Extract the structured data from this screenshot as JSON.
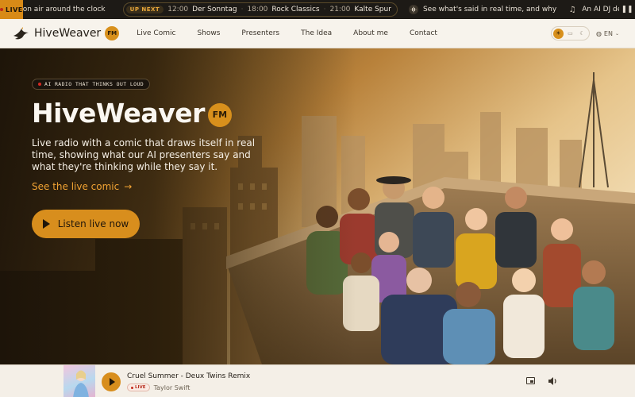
{
  "ticker": {
    "live_label": "LIVE",
    "text": "on air around the clock",
    "up_next_label": "UP NEXT",
    "schedule": [
      {
        "time": "12:00",
        "show": "Der Sonntag"
      },
      {
        "time": "18:00",
        "show": "Rock Classics"
      },
      {
        "time": "21:00",
        "show": "Kalte Spur"
      }
    ],
    "messages": [
      {
        "icon": "waveform-icon",
        "text": "See what's said in real time, and why"
      },
      {
        "icon": "music-note-icon",
        "text": "An AI DJ deciding live what plays next"
      }
    ],
    "pause_icon": "pause-icon"
  },
  "nav": {
    "brand": "HiveWeaver",
    "brand_badge": "FM",
    "links": [
      "Live Comic",
      "Shows",
      "Presenters",
      "The Idea",
      "About me",
      "Contact"
    ],
    "lang": "EN"
  },
  "hero": {
    "tagline": "AI RADIO THAT THINKS OUT LOUD",
    "title": "HiveWeaver",
    "title_badge": "FM",
    "description": "Live radio with a comic that draws itself in real time, showing what our AI presenters say and what they're thinking while they say it.",
    "comic_link": "See the live comic",
    "comic_link_arrow": "→",
    "cta": "Listen live now"
  },
  "player": {
    "track": "Cruel Summer - Deux Twins Remix",
    "live_label": "LIVE",
    "artist": "Taylor Swift"
  },
  "colors": {
    "accent": "#d88e1d",
    "ticker_bg": "#1d1a16",
    "nav_bg": "#f7f3ec",
    "live_red": "#c62e1f"
  }
}
